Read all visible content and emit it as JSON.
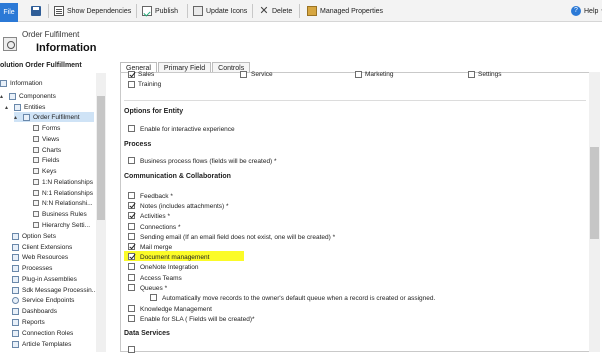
{
  "toolbar": {
    "file": "File",
    "show_dependencies": "Show Dependencies",
    "publish": "Publish",
    "update_icons": "Update Icons",
    "delete": "Delete",
    "managed_properties": "Managed Properties",
    "help": "Help"
  },
  "header": {
    "entity_name": "Order Fulfilment",
    "page_title": "Information"
  },
  "nav": {
    "solution_title": "olution Order Fulfillment",
    "items": [
      {
        "label": "Information"
      },
      {
        "label": "Components"
      },
      {
        "label": "Entities"
      },
      {
        "label": "Order Fulfilment"
      },
      {
        "label": "Forms"
      },
      {
        "label": "Views"
      },
      {
        "label": "Charts"
      },
      {
        "label": "Fields"
      },
      {
        "label": "Keys"
      },
      {
        "label": "1:N Relationships"
      },
      {
        "label": "N:1 Relationships"
      },
      {
        "label": "N:N Relationshi..."
      },
      {
        "label": "Business Rules"
      },
      {
        "label": "Hierarchy Setti..."
      },
      {
        "label": "Option Sets"
      },
      {
        "label": "Client Extensions"
      },
      {
        "label": "Web Resources"
      },
      {
        "label": "Processes"
      },
      {
        "label": "Plug-in Assemblies"
      },
      {
        "label": "Sdk Message Processin..."
      },
      {
        "label": "Service Endpoints"
      },
      {
        "label": "Dashboards"
      },
      {
        "label": "Reports"
      },
      {
        "label": "Connection Roles"
      },
      {
        "label": "Article Templates"
      }
    ]
  },
  "tabs": [
    {
      "label": "General",
      "active": true
    },
    {
      "label": "Primary Field",
      "active": false
    },
    {
      "label": "Controls",
      "active": false
    }
  ],
  "form": {
    "top_row": {
      "sales": "Sales",
      "service": "Service",
      "marketing": "Marketing",
      "settings": "Settings",
      "training": "Training"
    },
    "options_for_entity": "Options for Entity",
    "enable_interactive": "Enable for interactive experience",
    "process": "Process",
    "business_process_flows": "Business process flows (fields will be created) *",
    "comm_collab": "Communication & Collaboration",
    "feedback": "Feedback *",
    "notes": "Notes (includes attachments) *",
    "activities": "Activities *",
    "connections": "Connections *",
    "sending_email": "Sending email (If an email field does not exist, one will be created) *",
    "mail_merge": "Mail merge",
    "document_management": "Document management",
    "onenote": "OneNote Integration",
    "access_teams": "Access Teams",
    "queues": "Queues *",
    "auto_move": "Automatically move records to the owner's default queue when a record is created or assigned.",
    "knowledge_management": "Knowledge Management",
    "enable_sla": "Enable for SLA ( Fields will be created)*",
    "data_services": "Data Services"
  },
  "colors": {
    "file_tab": "#2b79d6",
    "highlight": "#fbfb28",
    "selected_nav": "#cfe3f6"
  }
}
